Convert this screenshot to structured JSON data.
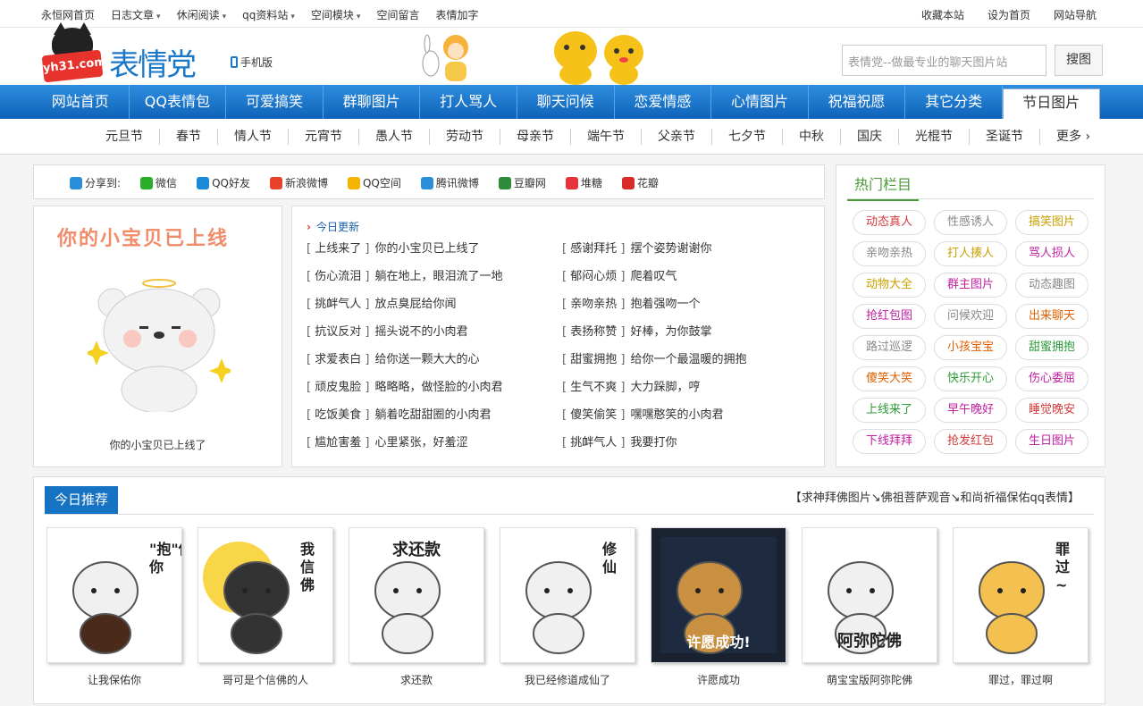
{
  "topbar": {
    "left": [
      "永恒网首页",
      "日志文章",
      "休闲阅读",
      "qq资料站",
      "空间模块",
      "空间留言",
      "表情加字"
    ],
    "right": [
      "收藏本站",
      "设为首页",
      "网站导航"
    ]
  },
  "header": {
    "logo_badge": "yh31.com",
    "logo_text": "表情党",
    "mobile": "手机版",
    "search_placeholder": "表情党--做最专业的聊天图片站",
    "search_button": "搜图"
  },
  "nav": [
    "网站首页",
    "QQ表情包",
    "可爱搞笑",
    "群聊图片",
    "打人骂人",
    "聊天问候",
    "恋爱情感",
    "心情图片",
    "祝福祝愿",
    "其它分类",
    "节日图片"
  ],
  "subnav": [
    "元旦节",
    "春节",
    "情人节",
    "元宵节",
    "愚人节",
    "劳动节",
    "母亲节",
    "端午节",
    "父亲节",
    "七夕节",
    "中秋",
    "国庆",
    "光棍节",
    "圣诞节",
    "更多"
  ],
  "share": {
    "label": "分享到:",
    "items": [
      {
        "name": "微信",
        "color": "#2aae2a"
      },
      {
        "name": "QQ好友",
        "color": "#1b8ad8"
      },
      {
        "name": "新浪微博",
        "color": "#e8422c"
      },
      {
        "name": "QQ空间",
        "color": "#f4b400"
      },
      {
        "name": "腾讯微博",
        "color": "#2a8ed8"
      },
      {
        "name": "豆瓣网",
        "color": "#2e8b3a"
      },
      {
        "name": "堆糖",
        "color": "#e8323c"
      },
      {
        "name": "花瓣",
        "color": "#d92a2a"
      }
    ]
  },
  "featured": {
    "title": "你的小宝贝已上线",
    "caption": "你的小宝贝已上线了"
  },
  "updates": {
    "header": "今日更新",
    "left": [
      {
        "cat": "上线来了",
        "title": "你的小宝贝已上线了"
      },
      {
        "cat": "伤心流泪",
        "title": "躺在地上，眼泪流了一地"
      },
      {
        "cat": "挑衅气人",
        "title": "放点臭屁给你闻"
      },
      {
        "cat": "抗议反对",
        "title": "摇头说不的小肉君"
      },
      {
        "cat": "求爱表白",
        "title": "给你送一颗大大的心"
      },
      {
        "cat": "顽皮鬼脸",
        "title": "略略略，做怪脸的小肉君"
      },
      {
        "cat": "吃饭美食",
        "title": "躺着吃甜甜圈的小肉君"
      },
      {
        "cat": "尴尬害羞",
        "title": "心里紧张，好羞涩"
      }
    ],
    "right": [
      {
        "cat": "感谢拜托",
        "title": "摆个姿势谢谢你"
      },
      {
        "cat": "郁闷心烦",
        "title": "爬着叹气"
      },
      {
        "cat": "亲吻亲热",
        "title": "抱着强吻一个"
      },
      {
        "cat": "表扬称赞",
        "title": "好棒，为你鼓掌"
      },
      {
        "cat": "甜蜜拥抱",
        "title": "给你一个最温暖的拥抱"
      },
      {
        "cat": "生气不爽",
        "title": "大力跺脚，哼"
      },
      {
        "cat": "傻笑偷笑",
        "title": "嘿嘿憨笑的小肉君"
      },
      {
        "cat": "挑衅气人",
        "title": "我要打你"
      }
    ]
  },
  "hot": {
    "header": "热门栏目",
    "tags": [
      {
        "t": "动态真人",
        "c": "#d43a3a"
      },
      {
        "t": "性感诱人",
        "c": "#888"
      },
      {
        "t": "搞笑图片",
        "c": "#c9a000"
      },
      {
        "t": "亲吻亲热",
        "c": "#888"
      },
      {
        "t": "打人揍人",
        "c": "#c9a000"
      },
      {
        "t": "骂人损人",
        "c": "#c020a0"
      },
      {
        "t": "动物大全",
        "c": "#c9a000"
      },
      {
        "t": "群主图片",
        "c": "#c020a0"
      },
      {
        "t": "动态趣图",
        "c": "#888"
      },
      {
        "t": "抢红包图",
        "c": "#c020a0"
      },
      {
        "t": "问候欢迎",
        "c": "#888"
      },
      {
        "t": "出来聊天",
        "c": "#e06000"
      },
      {
        "t": "路过巡逻",
        "c": "#888"
      },
      {
        "t": "小孩宝宝",
        "c": "#e06000"
      },
      {
        "t": "甜蜜拥抱",
        "c": "#2e9a3a"
      },
      {
        "t": "傻笑大笑",
        "c": "#e06000"
      },
      {
        "t": "快乐开心",
        "c": "#2e9a3a"
      },
      {
        "t": "伤心委屈",
        "c": "#c020a0"
      },
      {
        "t": "上线来了",
        "c": "#2e9a3a"
      },
      {
        "t": "早午晚好",
        "c": "#c020a0"
      },
      {
        "t": "睡觉晚安",
        "c": "#d43a3a"
      },
      {
        "t": "下线拜拜",
        "c": "#c020a0"
      },
      {
        "t": "抢发红包",
        "c": "#d43a3a"
      },
      {
        "t": "生日图片",
        "c": "#c020a0"
      }
    ]
  },
  "recommend": {
    "header": "今日推荐",
    "bread": "【求神拜佛图片↘佛祖菩萨观音↘和尚祈福保佑qq表情】",
    "cards": [
      {
        "caption": "让我保佑你",
        "text": "\"抱\"佑你"
      },
      {
        "caption": "哥可是个信佛的人",
        "text": "我信佛"
      },
      {
        "caption": "求还款",
        "text": "求还款"
      },
      {
        "caption": "我已经修道成仙了",
        "text": "修仙"
      },
      {
        "caption": "许愿成功",
        "text": "许愿成功!"
      },
      {
        "caption": "萌宝宝版阿弥陀佛",
        "text": "阿弥陀佛"
      },
      {
        "caption": "罪过，罪过啊",
        "text": "罪过~"
      }
    ]
  }
}
